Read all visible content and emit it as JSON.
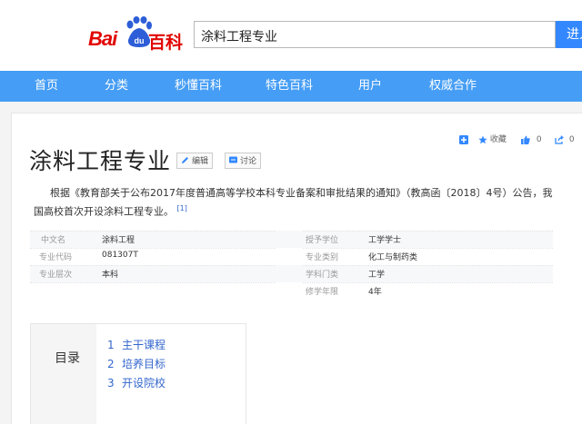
{
  "header": {
    "logo_bai": "Bai",
    "logo_du": "du",
    "logo_baike": "百科",
    "search_value": "涂料工程专业",
    "search_button": "进入"
  },
  "nav": {
    "items": [
      "首页",
      "分类",
      "秒懂百科",
      "特色百科",
      "用户",
      "权威合作"
    ]
  },
  "toolbar": {
    "favorite_label": "收藏",
    "like_count": "0",
    "share_count": "0"
  },
  "article": {
    "title": "涂料工程专业",
    "edit_button": "编辑",
    "discuss_button": "讨论",
    "summary": "根据《教育部关于公布2017年度普通高等学校本科专业备案和审批结果的通知》（教高函〔2018〕4号）公告，我国高校首次开设涂料工程专业。",
    "summary_ref": "[1]"
  },
  "basic_info": {
    "left": [
      {
        "label": "中文名",
        "value": "涂料工程"
      },
      {
        "label": "专业代码",
        "value": "081307T"
      },
      {
        "label": "专业层次",
        "value": "本科"
      }
    ],
    "right": [
      {
        "label": "授予学位",
        "value": "工学学士"
      },
      {
        "label": "专业类别",
        "value": "化工与制药类"
      },
      {
        "label": "学科门类",
        "value": "工学"
      },
      {
        "label": "修学年限",
        "value": "4年"
      }
    ]
  },
  "toc": {
    "title": "目录",
    "items": [
      {
        "num": "1",
        "label": "主干课程"
      },
      {
        "num": "2",
        "label": "培养目标"
      },
      {
        "num": "3",
        "label": "开设院校"
      }
    ]
  },
  "colors": {
    "brand_red": "#e10602",
    "brand_blue": "#2d5ed8",
    "nav_blue": "#459df5",
    "link_blue": "#3366cc"
  }
}
